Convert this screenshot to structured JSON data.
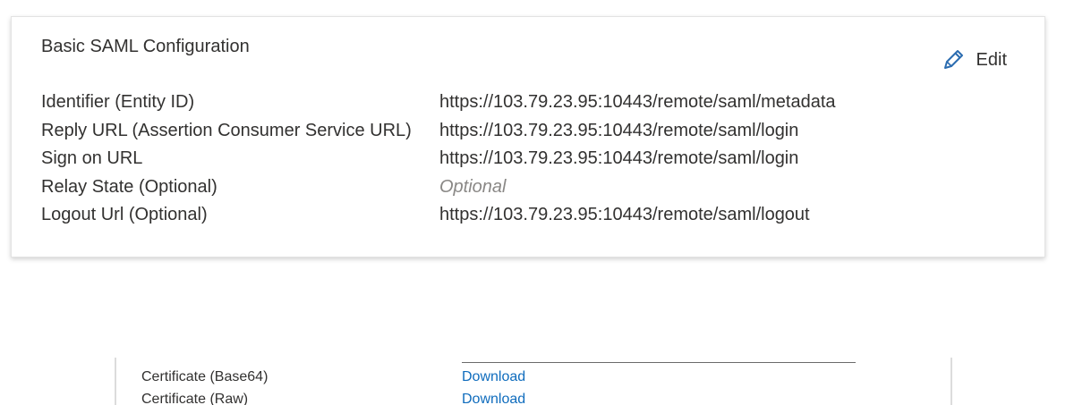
{
  "basic_saml": {
    "title": "Basic SAML Configuration",
    "edit_label": "Edit",
    "rows": [
      {
        "label": "Identifier (Entity ID)",
        "value": "https://103.79.23.95:10443/remote/saml/metadata"
      },
      {
        "label": "Reply URL (Assertion Consumer Service URL)",
        "value": "https://103.79.23.95:10443/remote/saml/login"
      },
      {
        "label": "Sign on URL",
        "value": "https://103.79.23.95:10443/remote/saml/login"
      },
      {
        "label": "Relay State (Optional)",
        "value": "Optional"
      },
      {
        "label": "Logout Url (Optional)",
        "value": "https://103.79.23.95:10443/remote/saml/logout"
      }
    ]
  },
  "certificates": {
    "rows": [
      {
        "label": "Certificate (Base64)",
        "link": "Download"
      },
      {
        "label": "Certificate (Raw)",
        "link": "Download"
      }
    ]
  },
  "colors": {
    "link": "#0f6cbd",
    "edit_icon": "#2b6cb0",
    "placeholder": "#8a8886"
  },
  "icons": {
    "edit": "pencil-icon"
  }
}
